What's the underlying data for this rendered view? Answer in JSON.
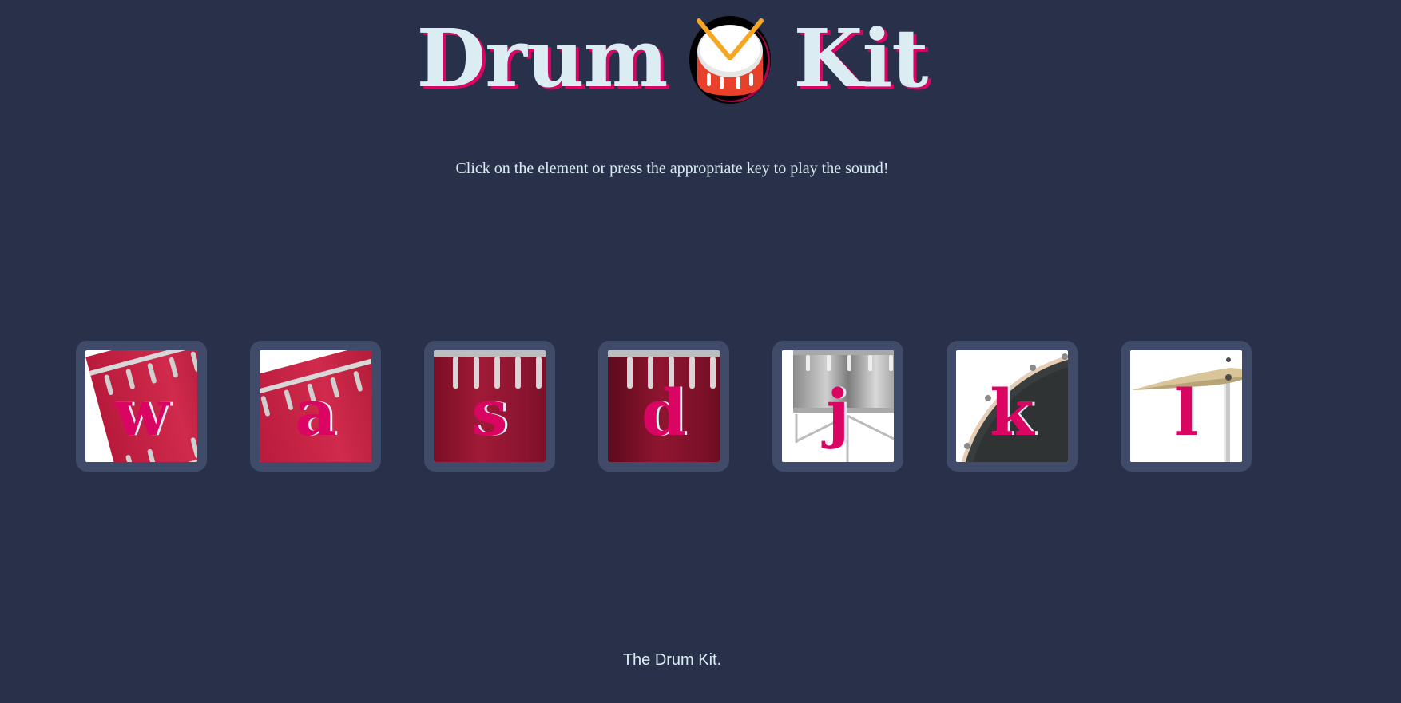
{
  "header": {
    "title_left": "Drum",
    "title_right": "Kit",
    "emoji_icon": "drum-icon"
  },
  "instructions": "Click on the element or press the appropriate key to play the sound!",
  "drums": [
    {
      "key": "w",
      "instrument_icon": "tom-drum-icon"
    },
    {
      "key": "a",
      "instrument_icon": "tom-drum-icon"
    },
    {
      "key": "s",
      "instrument_icon": "tom-drum-icon"
    },
    {
      "key": "d",
      "instrument_icon": "tom-drum-icon"
    },
    {
      "key": "j",
      "instrument_icon": "snare-drum-icon"
    },
    {
      "key": "k",
      "instrument_icon": "bass-drum-icon"
    },
    {
      "key": "l",
      "instrument_icon": "crash-cymbal-icon"
    }
  ],
  "footer": {
    "text": "The Drum Kit."
  },
  "colors": {
    "background": "#283149",
    "frame": "#404b69",
    "text": "#dbedf3",
    "accent": "#da0463"
  }
}
